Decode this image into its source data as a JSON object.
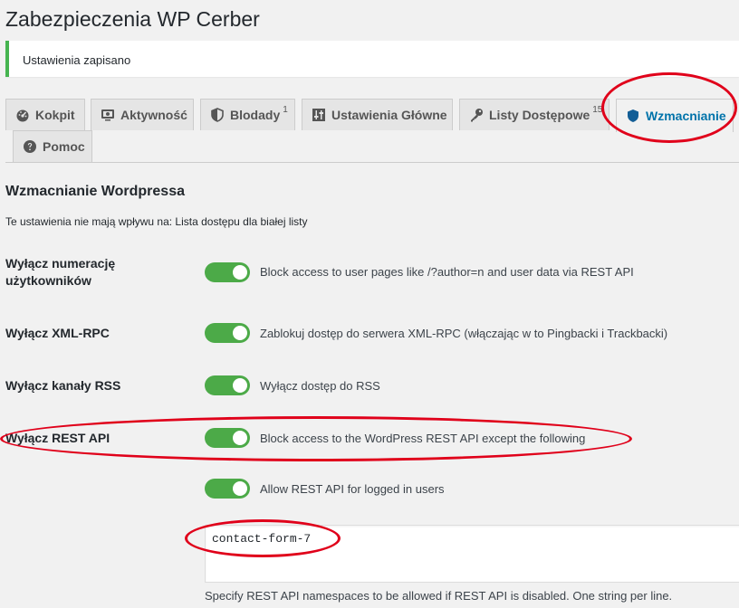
{
  "page": {
    "title": "Zabezpieczenia WP Cerber"
  },
  "notice": {
    "text": "Ustawienia zapisano"
  },
  "tabs": [
    {
      "label": "Kokpit",
      "icon": "dashboard-icon"
    },
    {
      "label": "Aktywność",
      "icon": "monitor-icon"
    },
    {
      "label": "Blodady",
      "badge": "1",
      "icon": "shield-icon"
    },
    {
      "label": "Ustawienia Główne",
      "icon": "sliders-icon"
    },
    {
      "label": "Listy Dostępowe",
      "badge": "15",
      "icon": "key-icon"
    },
    {
      "label": "Wzmacnianie",
      "icon": "shield-filled-icon",
      "active": true
    },
    {
      "label": "Pomoc",
      "icon": "help-icon"
    }
  ],
  "section": {
    "title": "Wzmacnianie Wordpressa",
    "description": "Te ustawienia nie mają wpływu na: Lista dostępu dla białej listy"
  },
  "settings": [
    {
      "label": "Wyłącz numerację użytkowników",
      "description": "Block access to user pages like /?author=n and user data via REST API",
      "enabled": true
    },
    {
      "label": "Wyłącz XML-RPC",
      "description": "Zablokuj dostęp do serwera XML-RPC (włączając w to Pingbacki i Trackbacki)",
      "enabled": true
    },
    {
      "label": "Wyłącz kanały RSS",
      "description": "Wyłącz dostęp do RSS",
      "enabled": true
    },
    {
      "label": "Wyłącz REST API",
      "description": "Block access to the WordPress REST API except the following",
      "enabled": true
    },
    {
      "label": "",
      "description": "Allow REST API for logged in users",
      "enabled": true
    }
  ],
  "namespaces": {
    "value": "contact-form-7",
    "help": "Specify REST API namespaces to be allowed if REST API is disabled. One string per line."
  },
  "colors": {
    "toggle_on": "#4caa48",
    "active_tab": "#0073aa",
    "annotation": "#e0001a",
    "notice_border": "#46b450"
  }
}
